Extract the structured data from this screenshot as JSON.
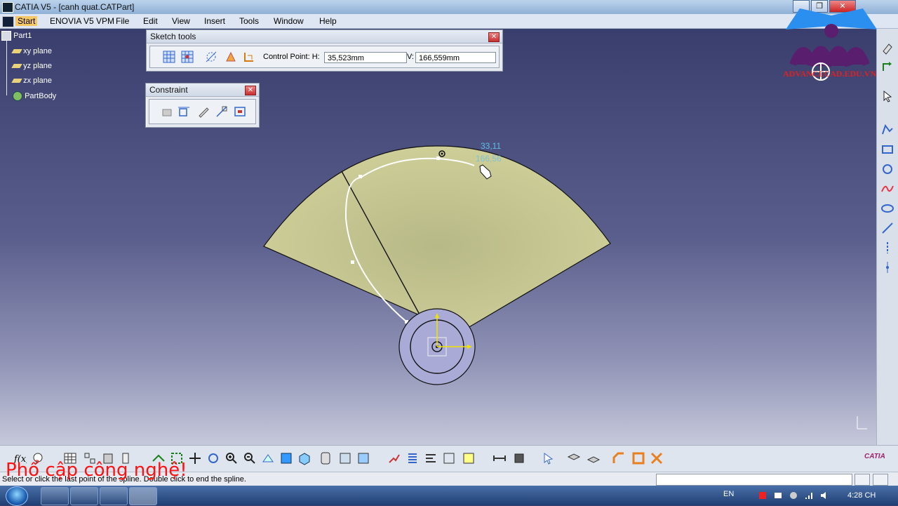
{
  "window": {
    "title": "CATIA V5 - [canh quat.CATPart]"
  },
  "menu": {
    "items": [
      "Start",
      "ENOVIA V5 VPM",
      "File",
      "Edit",
      "View",
      "Insert",
      "Tools",
      "Window",
      "Help"
    ],
    "active": "Start"
  },
  "tree": {
    "root": "Part1",
    "items": [
      "xy plane",
      "yz plane",
      "zx plane",
      "PartBody"
    ]
  },
  "sketch_tools": {
    "title": "Sketch tools",
    "control_point_label": "Control Point: H:",
    "h_value": "35,523mm",
    "v_label": "V:",
    "v_value": "166,559mm"
  },
  "constraint": {
    "title": "Constraint"
  },
  "canvas": {
    "coord_label": "33,11",
    "coord_label_2": "166,56"
  },
  "status": {
    "message": "Select or click the last point of the spline. Double click to end the spline."
  },
  "overlay": {
    "text": "Phổ cập công nghệ!"
  },
  "logo": {
    "text": "ADVANCECAD.EDU.VN"
  },
  "taskbar": {
    "lang": "EN",
    "time": "4:28 CH"
  },
  "brand": {
    "catia_logo": "CATIA"
  },
  "colors": {
    "fan_fill": "#c9c98a",
    "hub_fill": "#a9aad6",
    "spline": "#ffffff",
    "viewport_top": "#3a3e6d"
  }
}
